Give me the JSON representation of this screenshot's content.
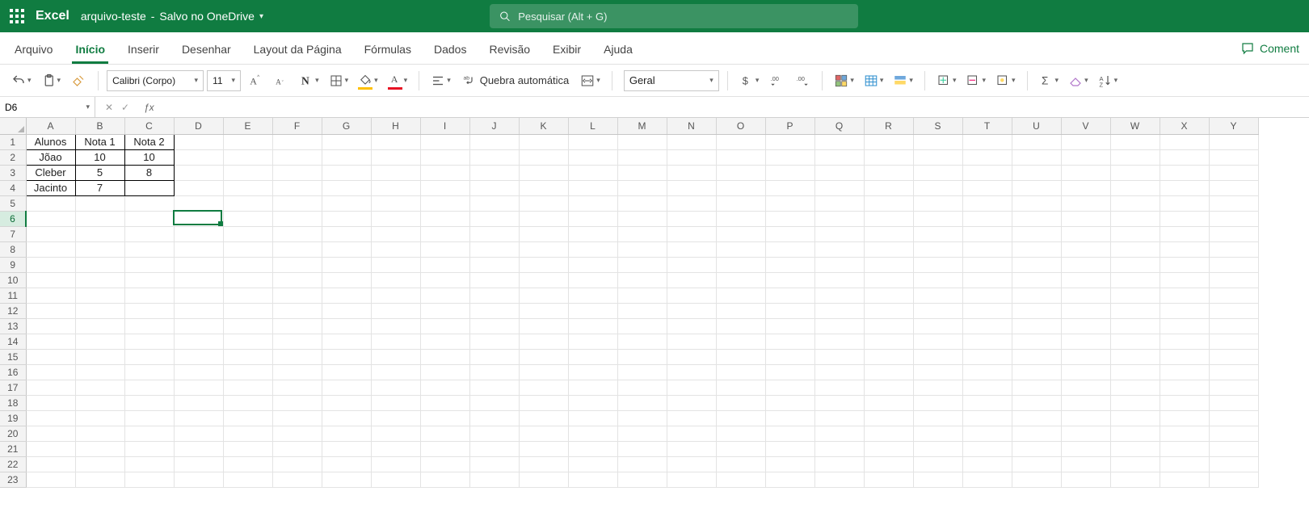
{
  "header": {
    "app_name": "Excel",
    "file_name": "arquivo-teste",
    "save_status": "Salvo no OneDrive",
    "search_placeholder": "Pesquisar (Alt + G)"
  },
  "tabs": {
    "items": [
      "Arquivo",
      "Início",
      "Inserir",
      "Desenhar",
      "Layout da Página",
      "Fórmulas",
      "Dados",
      "Revisão",
      "Exibir",
      "Ajuda"
    ],
    "active_index": 1,
    "comments_label": "Coment"
  },
  "ribbon": {
    "font_name": "Calibri (Corpo)",
    "font_size": "11",
    "wrap_text_label": "Quebra automática",
    "number_format": "Geral"
  },
  "formula_bar": {
    "name_box": "D6",
    "formula": ""
  },
  "grid": {
    "columns": [
      "A",
      "B",
      "C",
      "D",
      "E",
      "F",
      "G",
      "H",
      "I",
      "J",
      "K",
      "L",
      "M",
      "N",
      "O",
      "P",
      "Q",
      "R",
      "S",
      "T",
      "U",
      "V",
      "W",
      "X",
      "Y"
    ],
    "row_count": 23,
    "active_row": 6,
    "active_col_index": 3,
    "data": {
      "headers": [
        "Alunos",
        "Nota 1",
        "Nota 2"
      ],
      "rows": [
        {
          "aluno": "Jõao",
          "nota1": "10",
          "nota2": "10"
        },
        {
          "aluno": "Cleber",
          "nota1": "5",
          "nota2": "8"
        },
        {
          "aluno": "Jacinto",
          "nota1": "7",
          "nota2": ""
        }
      ]
    }
  }
}
